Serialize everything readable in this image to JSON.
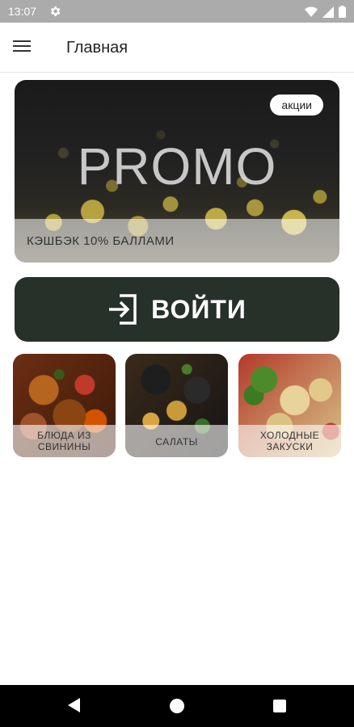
{
  "status_bar": {
    "time": "13:07",
    "icons": [
      "gear-icon",
      "wifi-icon",
      "signal-icon",
      "battery-icon"
    ]
  },
  "app_bar": {
    "title": "Главная",
    "menu_icon": "hamburger-menu-icon"
  },
  "promo": {
    "word": "PROMO",
    "badge": "акции",
    "caption": "КЭШБЭК 10% БАЛЛАМИ"
  },
  "login": {
    "label": "ВОЙТИ",
    "icon": "login-icon",
    "color": "#263129"
  },
  "categories": [
    {
      "line1": "БЛЮДА ИЗ",
      "line2": "СВИНИНЫ"
    },
    {
      "line1": "САЛАТЫ",
      "line2": ""
    },
    {
      "line1": "ХОЛОДНЫЕ",
      "line2": "ЗАКУСКИ"
    }
  ],
  "nav_bar": {
    "icons": [
      "back-icon",
      "home-icon",
      "recents-icon"
    ]
  }
}
